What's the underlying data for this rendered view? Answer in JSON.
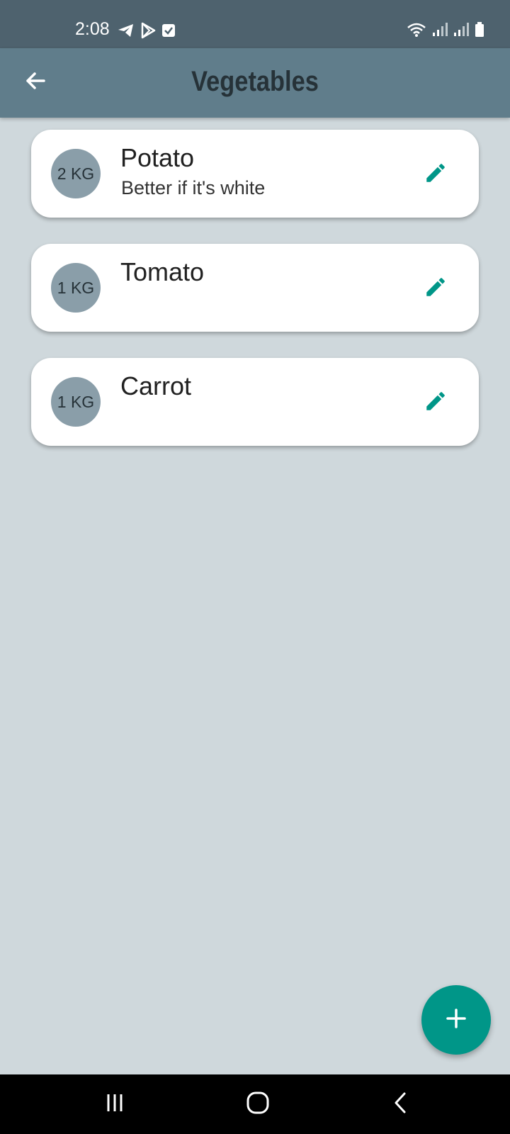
{
  "status_bar": {
    "time": "2:08",
    "left_icons": [
      "telegram-icon",
      "play-store-icon",
      "check-box-icon"
    ],
    "right_icons": [
      "wifi-icon",
      "signal-icon",
      "signal-icon",
      "battery-icon"
    ]
  },
  "app_bar": {
    "title": "Vegetables",
    "back_icon": "arrow-back-icon",
    "background": "#607d8b"
  },
  "items": [
    {
      "quantity": "2 KG",
      "name": "Potato",
      "note": "Better if it's white"
    },
    {
      "quantity": "1 KG",
      "name": "Tomato",
      "note": ""
    },
    {
      "quantity": "1 KG",
      "name": "Carrot",
      "note": ""
    }
  ],
  "fab": {
    "icon": "plus-icon",
    "color": "#009688"
  },
  "colors": {
    "accent": "#009688",
    "background": "#cfd8dc",
    "status_bar": "#4e626e",
    "avatar": "#8a9ea9"
  },
  "nav_bar": {
    "icons": [
      "recent-apps-icon",
      "home-icon",
      "back-icon"
    ]
  }
}
